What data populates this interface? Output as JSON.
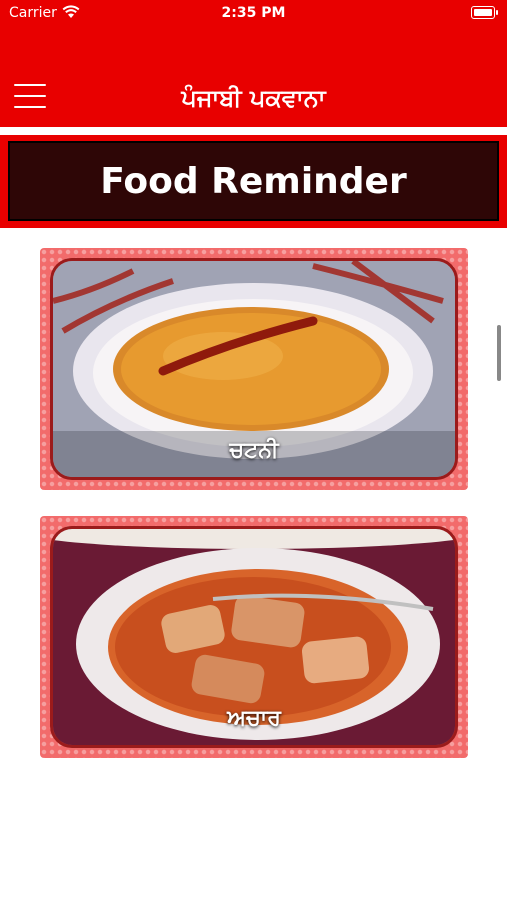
{
  "status_bar": {
    "carrier": "Carrier",
    "time": "2:35 PM"
  },
  "header": {
    "title": "ਪੰਜਾਬੀ ਪਕਵਾਨਾ"
  },
  "banner": {
    "title": "Food Reminder"
  },
  "cards": [
    {
      "label": "ਚਟਨੀ"
    },
    {
      "label": "ਅਚਾਰ"
    }
  ],
  "colors": {
    "header_bg": "#e80000",
    "banner_bg": "#2e0606",
    "card_bg": "#f26b6b"
  }
}
